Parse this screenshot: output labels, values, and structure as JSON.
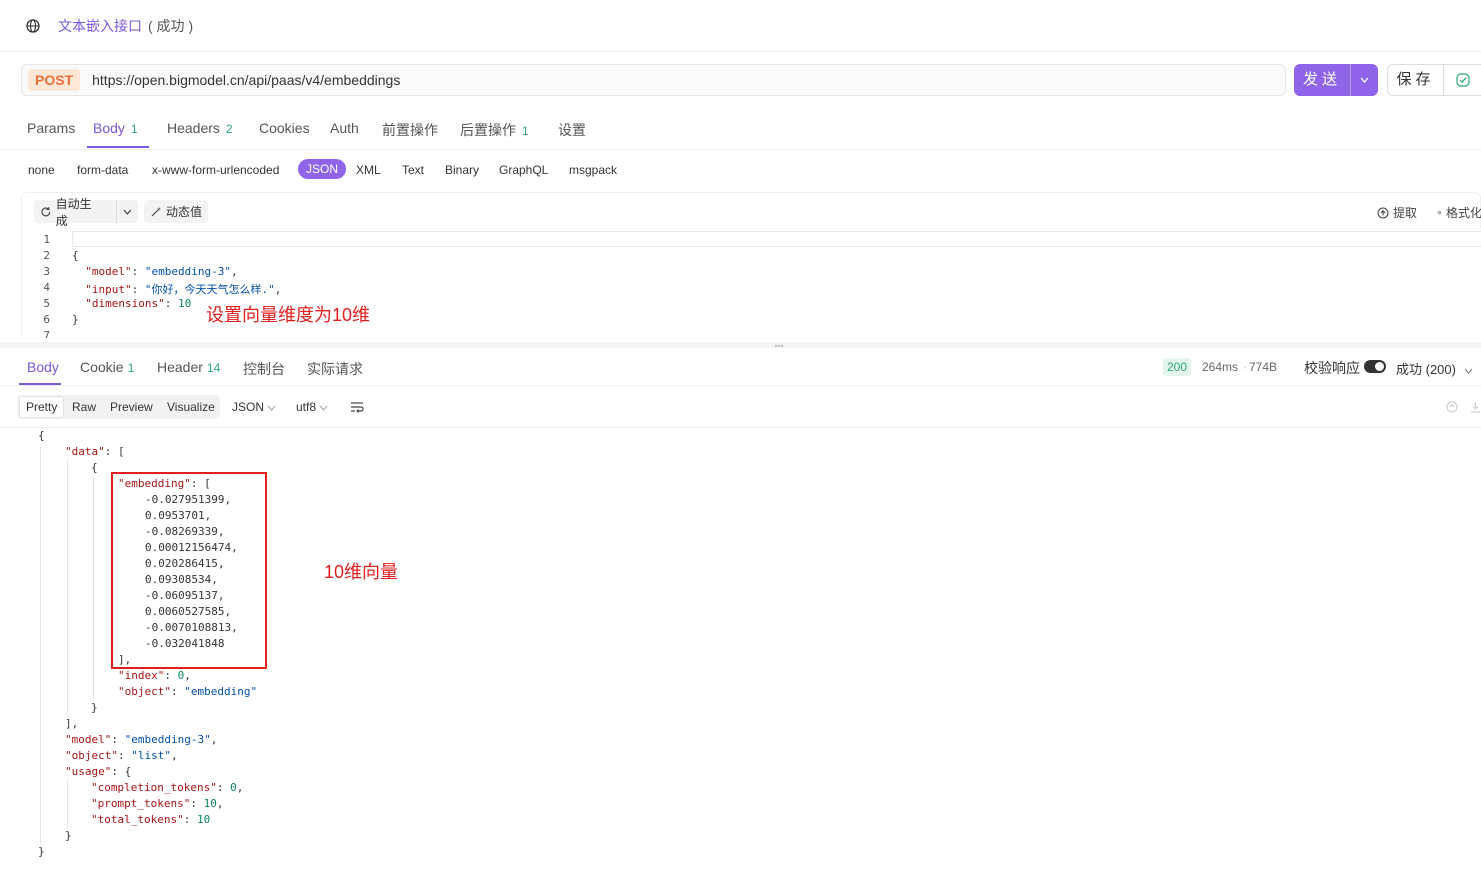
{
  "title": {
    "name": "文本嵌入接口",
    "status": "( 成功 )"
  },
  "request": {
    "method": "POST",
    "url": "https://open.bigmodel.cn/api/paas/v4/embeddings",
    "send_label": "发送",
    "save_label": "保存"
  },
  "req_tabs": [
    {
      "label": "Params",
      "count": ""
    },
    {
      "label": "Body",
      "count": "1"
    },
    {
      "label": "Headers",
      "count": "2"
    },
    {
      "label": "Cookies",
      "count": ""
    },
    {
      "label": "Auth",
      "count": ""
    },
    {
      "label": "前置操作",
      "count": ""
    },
    {
      "label": "后置操作",
      "count": "1"
    },
    {
      "label": "设置",
      "count": ""
    }
  ],
  "body_types": [
    "none",
    "form-data",
    "x-www-form-urlencoded",
    "JSON",
    "XML",
    "Text",
    "Binary",
    "GraphQL",
    "msgpack"
  ],
  "editor_toolbar": {
    "auto_generate": "自动生成",
    "dynamic_value": "动态值",
    "extract": "提取",
    "format": "格式化"
  },
  "request_body": {
    "line_numbers": [
      "1",
      "2",
      "3",
      "4",
      "5",
      "6",
      "7"
    ],
    "brace_open": "{",
    "brace_close": "}",
    "model_key": "\"model\"",
    "model_val": "\"embedding-3\"",
    "input_key": "\"input\"",
    "input_val": "\"你好，今天天气怎么样.\"",
    "dimensions_key": "\"dimensions\"",
    "dimensions_val": "10"
  },
  "annotations": {
    "dimensions_note": "设置向量维度为10维",
    "vector_note": "10维向量"
  },
  "response_tabs": [
    {
      "label": "Body",
      "count": ""
    },
    {
      "label": "Cookie",
      "count": "1"
    },
    {
      "label": "Header",
      "count": "14"
    },
    {
      "label": "控制台",
      "count": ""
    },
    {
      "label": "实际请求",
      "count": ""
    }
  ],
  "response_meta": {
    "status_code": "200",
    "time": "264ms",
    "size": "774B",
    "validate_label": "校验响应",
    "result": "成功 (200)"
  },
  "view_options": [
    "Pretty",
    "Raw",
    "Preview",
    "Visualize"
  ],
  "view_format": "JSON",
  "view_encoding": "utf8",
  "response_body": {
    "embedding": [
      "-0.027951399",
      "0.0953701",
      "-0.08269339",
      "0.00012156474",
      "0.020286415",
      "0.09308534",
      "-0.06095137",
      "0.0060527585",
      "-0.0070108813",
      "-0.032041848"
    ],
    "index": "0",
    "object_item": "\"embedding\"",
    "model": "\"embedding-3\"",
    "object": "\"list\"",
    "completion_tokens": "0",
    "prompt_tokens": "10",
    "total_tokens": "10"
  },
  "colors": {
    "accent": "#9064e9",
    "method": "#e8713a",
    "annotation": "#e02020",
    "success": "#2aa873"
  }
}
